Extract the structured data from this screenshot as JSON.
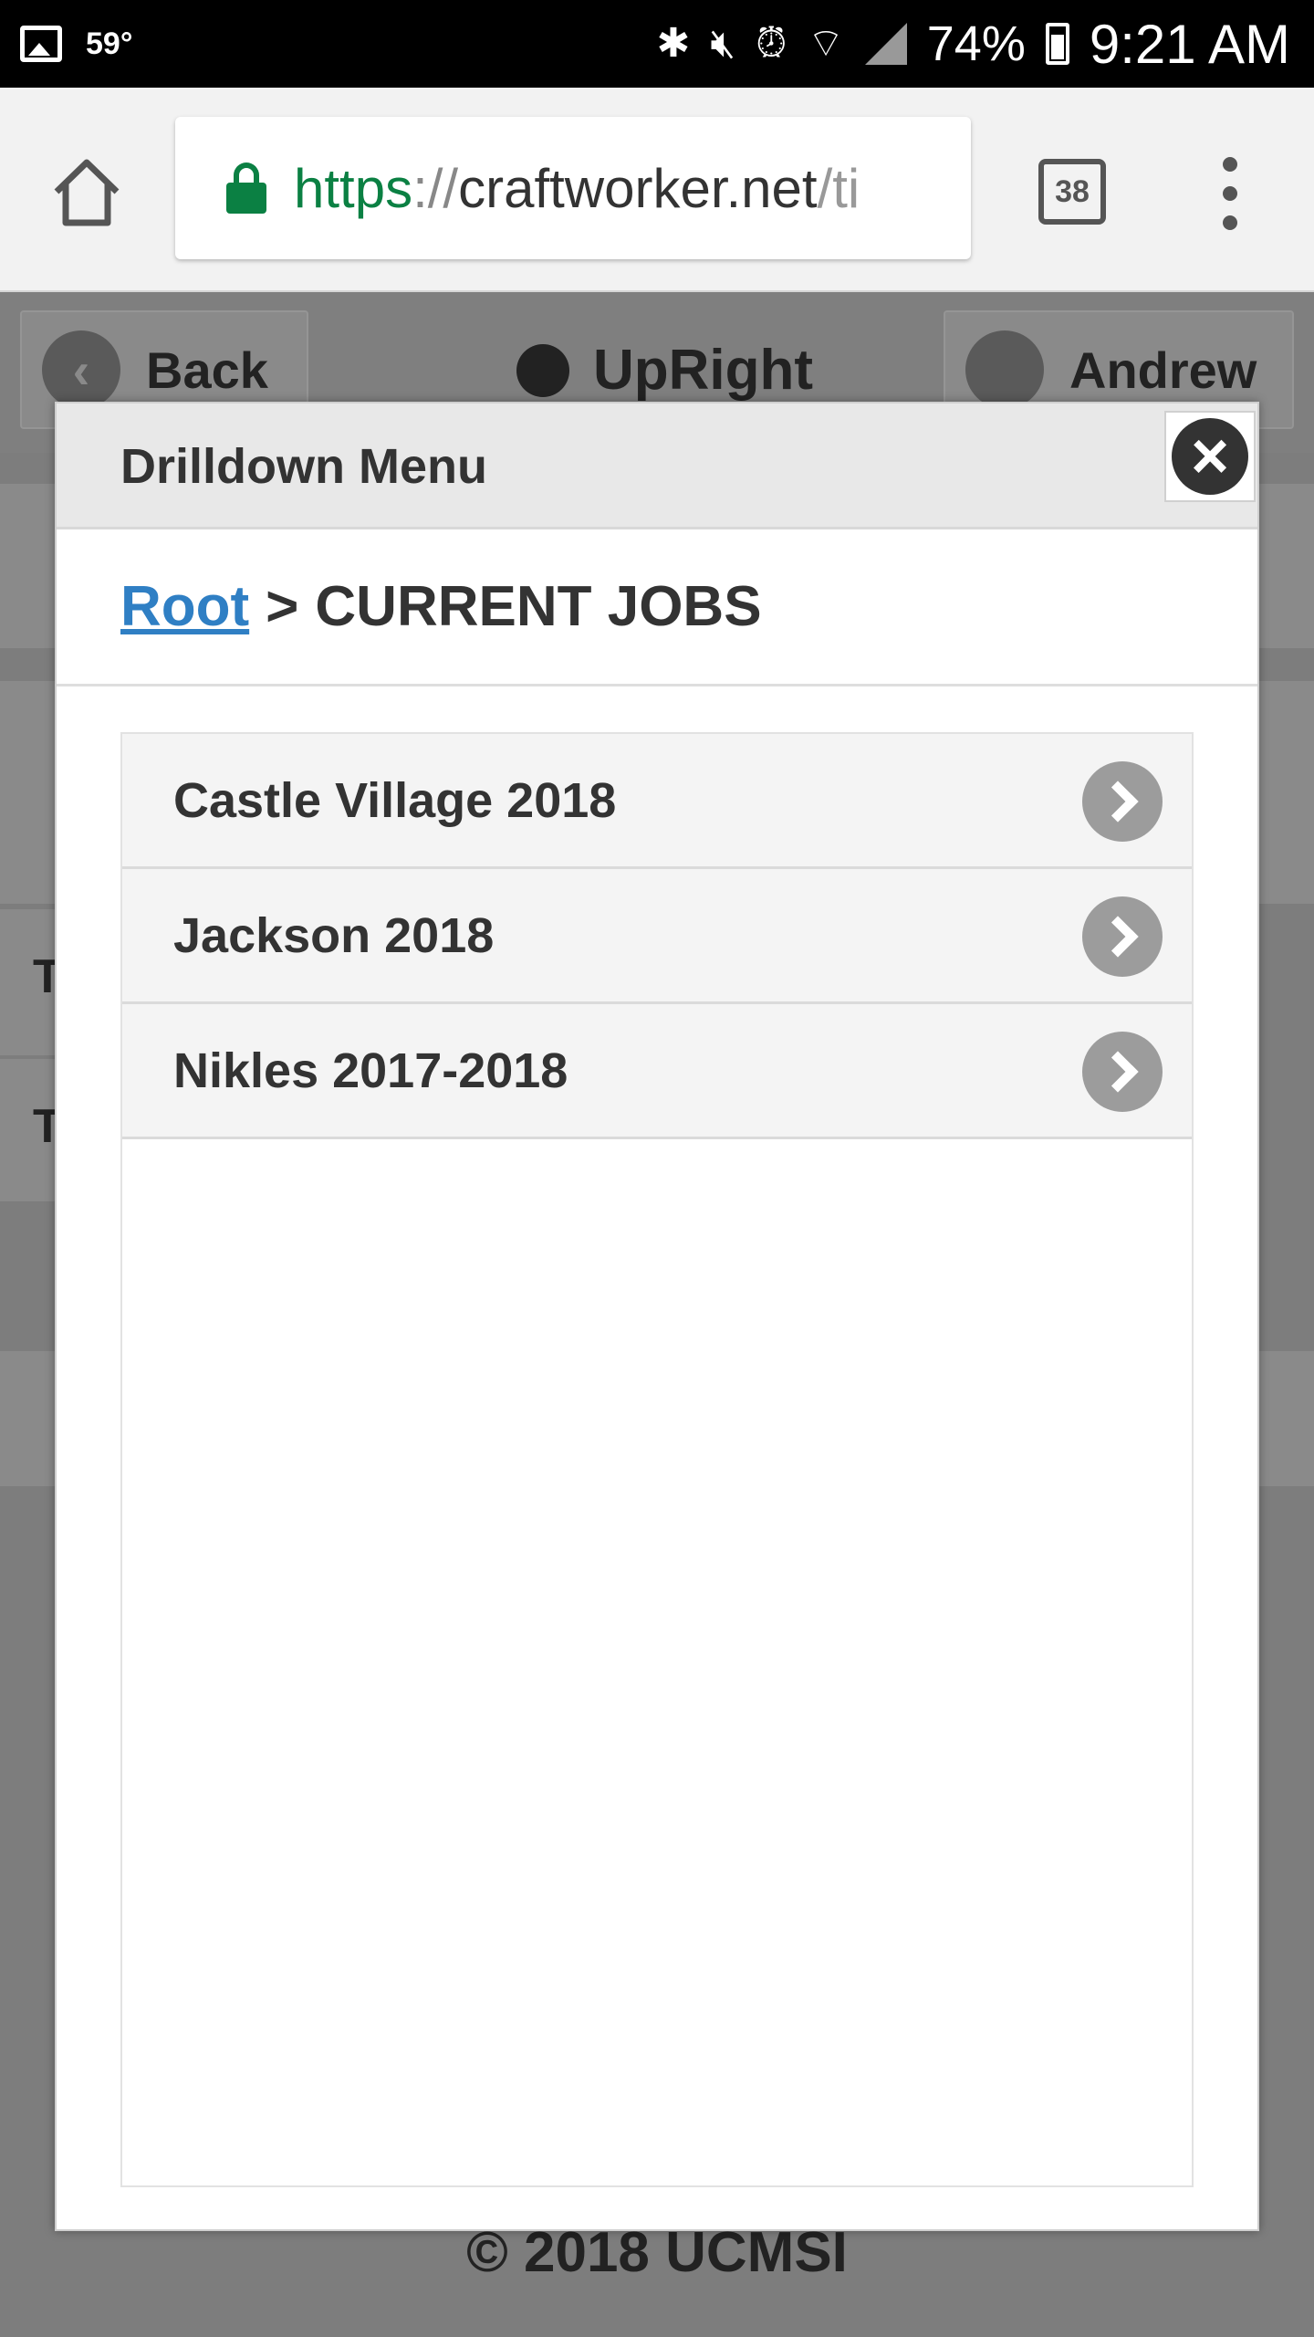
{
  "status_bar": {
    "temperature": "59°",
    "battery": "74%",
    "time": "9:21 AM",
    "icons": [
      "image-icon",
      "bluetooth-icon",
      "mute-icon",
      "alarm-icon",
      "wifi-icon",
      "signal-icon",
      "battery-icon"
    ]
  },
  "browser": {
    "url_scheme": "https",
    "url_sep": "://",
    "url_host": "craftworker.net",
    "url_path": "/ti",
    "tab_count": "38"
  },
  "page": {
    "back_label": "Back",
    "title": "UpRight",
    "user_name": "Andrew",
    "bg_letter_1": "T",
    "bg_letter_2": "T",
    "footer": "© 2018 UCMSI"
  },
  "modal": {
    "title": "Drilldown Menu",
    "breadcrumb": {
      "root_label": "Root",
      "separator": ">",
      "current": "CURRENT JOBS"
    },
    "items": [
      {
        "label": "Castle Village 2018"
      },
      {
        "label": "Jackson 2018"
      },
      {
        "label": "Nikles 2017-2018"
      }
    ]
  },
  "colors": {
    "link": "#2f7fc4",
    "secure_green": "#0b8043",
    "overlay_gray": "#7d7d7d"
  }
}
